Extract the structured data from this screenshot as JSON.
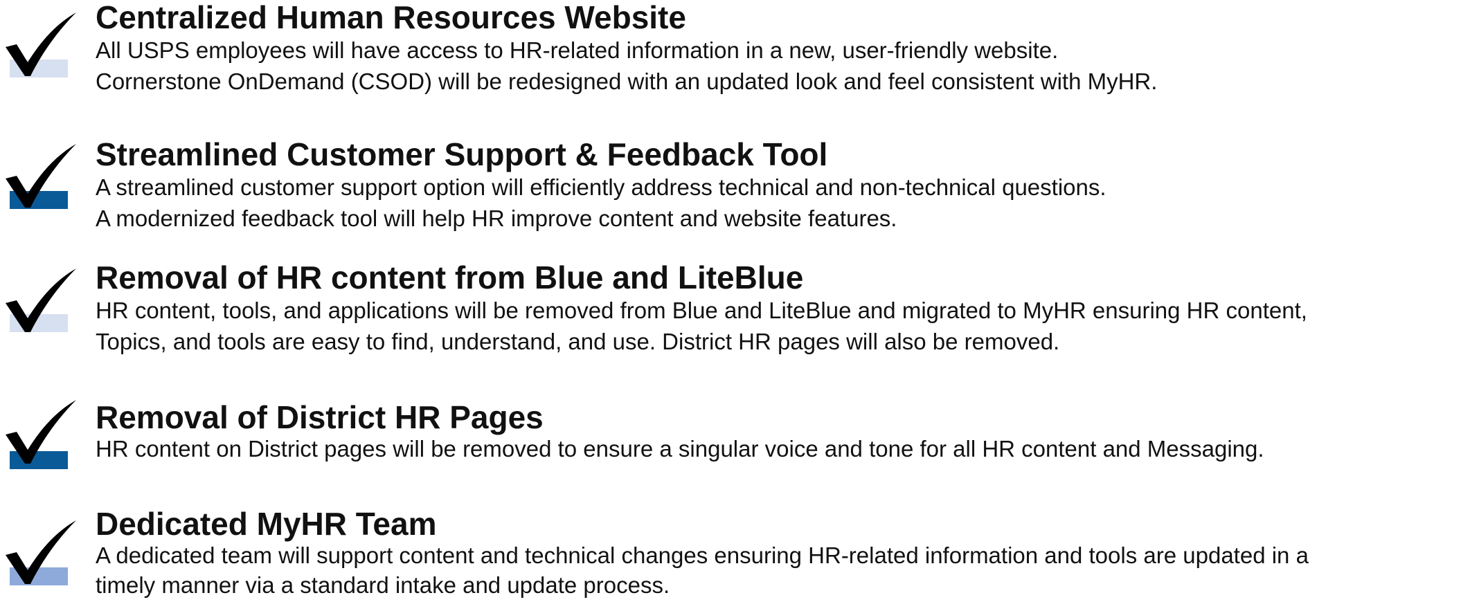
{
  "colors": {
    "check": "#000000",
    "bar_light": "#d6e0f0",
    "bar_dark": "#0a5a98",
    "bar_medium": "#8eaadb"
  },
  "items": [
    {
      "title": "Centralized Human Resources Website",
      "lines": [
        "All USPS employees will have access to HR-related information in a new, user-friendly website.",
        "Cornerstone OnDemand (CSOD) will be redesigned with an updated look and feel consistent with MyHR."
      ],
      "icon": "checkmark-icon",
      "bar_color": "#d6e0f0"
    },
    {
      "title": "Streamlined Customer Support & Feedback Tool",
      "lines": [
        "A streamlined customer support option will efficiently address technical and non-technical questions.",
        "A modernized feedback tool will help HR improve content and website features."
      ],
      "icon": "checkmark-icon",
      "bar_color": "#0a5a98"
    },
    {
      "title": "Removal of HR content from Blue and LiteBlue",
      "lines": [
        "HR content, tools, and applications will be removed from Blue and LiteBlue and migrated to MyHR ensuring HR content,",
        "Topics, and tools are easy to find, understand, and use. District HR pages will also be removed."
      ],
      "icon": "checkmark-icon",
      "bar_color": "#d6e0f0"
    },
    {
      "title": "Removal of District HR Pages",
      "lines": [
        "HR content on District pages will be removed to ensure a singular voice and tone for all HR content and Messaging."
      ],
      "icon": "checkmark-icon",
      "bar_color": "#0a5a98"
    },
    {
      "title": "Dedicated MyHR Team",
      "lines": [
        "A dedicated team will support content and technical changes ensuring HR-related information and tools are updated in a",
        "timely manner via a standard intake and update process."
      ],
      "icon": "checkmark-icon",
      "bar_color": "#8eaadb"
    }
  ]
}
